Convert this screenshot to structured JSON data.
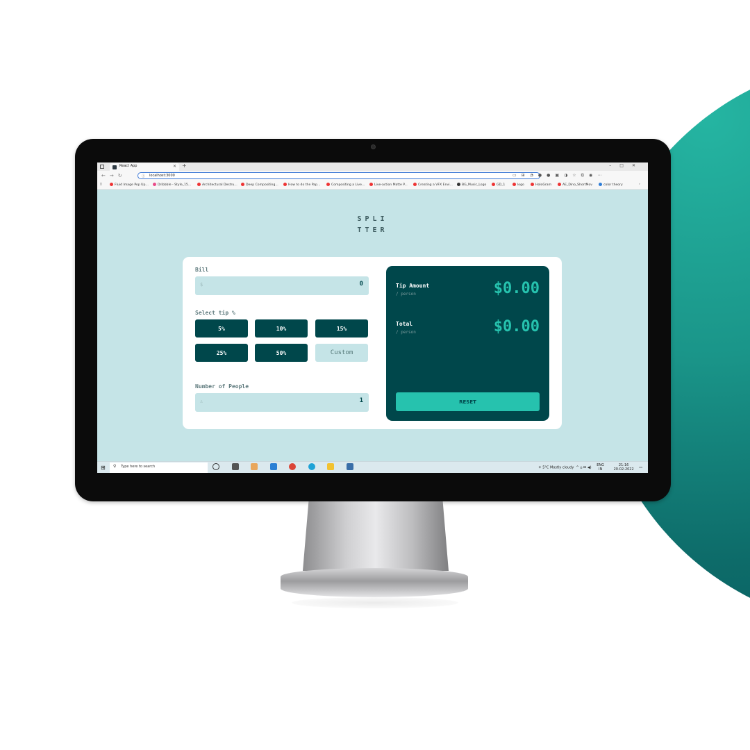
{
  "browser": {
    "tab_title": "React App",
    "url": "localhost:3000",
    "bookmarks": [
      "Fluid Image Pop Up...",
      "Dribbble - Style_15...",
      "Architectural Destru...",
      "Deep Compositing...",
      "How to do the Pap...",
      "Compositing a Live...",
      "Live-action Matte P...",
      "Creating a VFX Envi...",
      "BG_Music_Logo",
      "GD_1",
      "logo",
      "HoloGram",
      "AE_Dino_ShortMov",
      "color theory"
    ]
  },
  "app": {
    "logo_line1": "SPLI",
    "logo_line2": "TTER",
    "bill": {
      "label": "Bill",
      "icon": "$",
      "value": "0"
    },
    "tip": {
      "label": "Select tip %",
      "options": [
        "5%",
        "10%",
        "15%",
        "25%",
        "50%"
      ],
      "custom": "Custom"
    },
    "people": {
      "label": "Number of People",
      "icon": "♙",
      "value": "1"
    },
    "result": {
      "tip_amount_label": "Tip Amount",
      "tip_amount_sub": "/ person",
      "tip_amount_value": "$0.00",
      "total_label": "Total",
      "total_sub": "/ person",
      "total_value": "$0.00",
      "reset": "RESET"
    }
  },
  "taskbar": {
    "search_placeholder": "Type here to search",
    "weather": "5°C  Mostly cloudy",
    "lang": "ENG",
    "lang_region": "IN",
    "time": "21:16",
    "date": "20-02-2022"
  },
  "colors": {
    "app_bg": "#c5e4e7",
    "dark_cyan": "#00474b",
    "strong_cyan": "#26c2ae",
    "decor_teal": "#1a9589"
  }
}
